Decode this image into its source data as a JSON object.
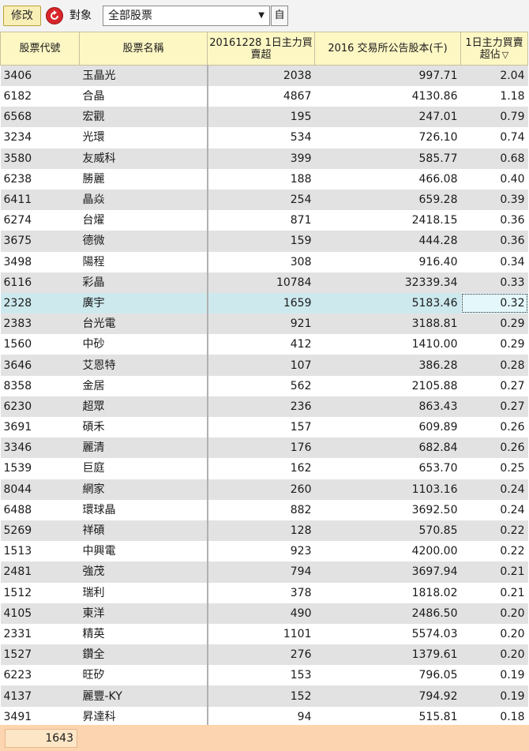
{
  "toolbar": {
    "modify_label": "修改",
    "target_label": "對象",
    "target_value": "全部股票",
    "self_label": "自"
  },
  "table": {
    "headers": [
      "股票代號",
      "股票名稱",
      "20161228 1日主力買賣超",
      "2016 交易所公告股本(千)",
      "1日主力買賣超佔"
    ],
    "rows": [
      [
        "3406",
        "玉晶光",
        "2038",
        "997.71",
        "2.04"
      ],
      [
        "6182",
        "合晶",
        "4867",
        "4130.86",
        "1.18"
      ],
      [
        "6568",
        "宏觀",
        "195",
        "247.01",
        "0.79"
      ],
      [
        "3234",
        "光環",
        "534",
        "726.10",
        "0.74"
      ],
      [
        "3580",
        "友威科",
        "399",
        "585.77",
        "0.68"
      ],
      [
        "6238",
        "勝麗",
        "188",
        "466.08",
        "0.40"
      ],
      [
        "6411",
        "晶焱",
        "254",
        "659.28",
        "0.39"
      ],
      [
        "6274",
        "台燿",
        "871",
        "2418.15",
        "0.36"
      ],
      [
        "3675",
        "德微",
        "159",
        "444.28",
        "0.36"
      ],
      [
        "3498",
        "陽程",
        "308",
        "916.40",
        "0.34"
      ],
      [
        "6116",
        "彩晶",
        "10784",
        "32339.34",
        "0.33"
      ],
      [
        "2328",
        "廣宇",
        "1659",
        "5183.46",
        "0.32"
      ],
      [
        "2383",
        "台光電",
        "921",
        "3188.81",
        "0.29"
      ],
      [
        "1560",
        "中砂",
        "412",
        "1410.00",
        "0.29"
      ],
      [
        "3646",
        "艾恩特",
        "107",
        "386.28",
        "0.28"
      ],
      [
        "8358",
        "金居",
        "562",
        "2105.88",
        "0.27"
      ],
      [
        "6230",
        "超眾",
        "236",
        "863.43",
        "0.27"
      ],
      [
        "3691",
        "碩禾",
        "157",
        "609.89",
        "0.26"
      ],
      [
        "3346",
        "麗清",
        "176",
        "682.84",
        "0.26"
      ],
      [
        "1539",
        "巨庭",
        "162",
        "653.70",
        "0.25"
      ],
      [
        "8044",
        "網家",
        "260",
        "1103.16",
        "0.24"
      ],
      [
        "6488",
        "環球晶",
        "882",
        "3692.50",
        "0.24"
      ],
      [
        "5269",
        "祥碩",
        "128",
        "570.85",
        "0.22"
      ],
      [
        "1513",
        "中興電",
        "923",
        "4200.00",
        "0.22"
      ],
      [
        "2481",
        "強茂",
        "794",
        "3697.94",
        "0.21"
      ],
      [
        "1512",
        "瑞利",
        "378",
        "1818.02",
        "0.21"
      ],
      [
        "4105",
        "東洋",
        "490",
        "2486.50",
        "0.20"
      ],
      [
        "2331",
        "精英",
        "1101",
        "5574.03",
        "0.20"
      ],
      [
        "1527",
        "鑽全",
        "276",
        "1379.61",
        "0.20"
      ],
      [
        "6223",
        "旺矽",
        "153",
        "796.05",
        "0.19"
      ],
      [
        "4137",
        "麗豐-KY",
        "152",
        "794.92",
        "0.19"
      ],
      [
        "3491",
        "昇達科",
        "94",
        "515.81",
        "0.18"
      ]
    ],
    "selected_row": 11
  },
  "footer": {
    "count": "1643"
  },
  "colors": {
    "header_bg": "#fdf7c4",
    "stripe": "#e2e2e2",
    "selected": "#cde9ee",
    "footer_bg": "#fcd5b0",
    "refresh_icon": "#d7262a"
  }
}
